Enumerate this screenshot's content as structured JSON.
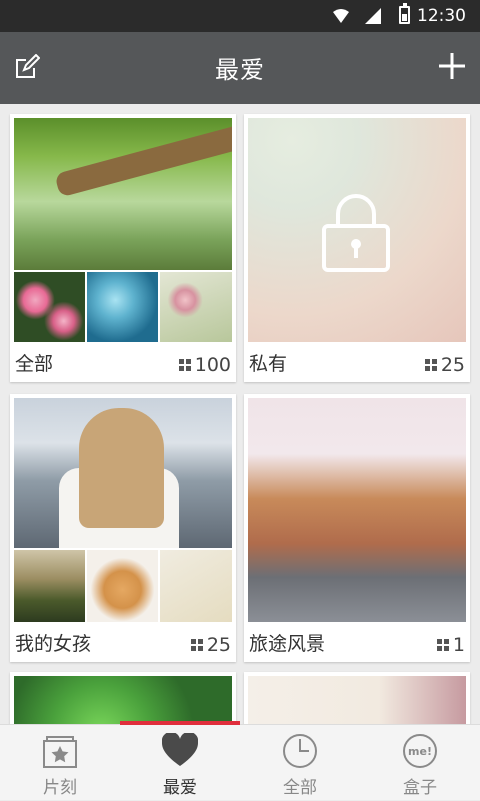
{
  "status_bar": {
    "time": "12:30"
  },
  "header": {
    "title": "最爱"
  },
  "albums": [
    {
      "label": "全部",
      "count": "100"
    },
    {
      "label": "私有",
      "count": "25"
    },
    {
      "label": "我的女孩",
      "count": "25"
    },
    {
      "label": "旅途风景",
      "count": "1"
    }
  ],
  "tabbar": {
    "active": "最爱",
    "tabs": [
      {
        "label": "片刻",
        "icon": "moments-icon"
      },
      {
        "label": "最爱",
        "icon": "heart-icon"
      },
      {
        "label": "全部",
        "icon": "clock-icon"
      },
      {
        "label": "盒子",
        "icon": "box-icon"
      }
    ]
  },
  "colors": {
    "header_bg": "#555759",
    "status_bg": "#2b2b2b",
    "accent": "#e02e3c"
  }
}
